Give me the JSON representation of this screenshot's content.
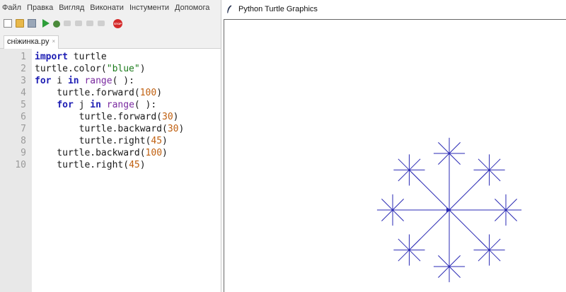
{
  "ide": {
    "menu": [
      "Файл",
      "Правка",
      "Вигляд",
      "Виконати",
      "Інстументи",
      "Допомога"
    ],
    "toolbar": {
      "icons": [
        "new-file-icon",
        "open-folder-icon",
        "save-icon",
        "run-icon",
        "debug-icon",
        "step-over-icon",
        "step-into-icon",
        "step-out-icon",
        "resume-icon",
        "stop-icon"
      ],
      "stop_label": "STOP"
    },
    "tab": {
      "label": "сніжинка.py",
      "close": "×"
    },
    "code_lines": [
      "import turtle",
      "turtle.color(\"blue\")",
      "for i in range( ):",
      "    turtle.forward(100)",
      "    for j in range( ):",
      "        turtle.forward(30)",
      "        turtle.backward(30)",
      "        turtle.right(45)",
      "    turtle.backward(100)",
      "    turtle.right(45)"
    ],
    "line_numbers": [
      "1",
      "2",
      "3",
      "4",
      "5",
      "6",
      "7",
      "8",
      "9",
      "10"
    ]
  },
  "turtle_window": {
    "title": "Python Turtle Graphics",
    "drawing": {
      "color": "#2a2ab4",
      "arm_count": 8,
      "arm_length": 100,
      "branch_length": 30,
      "branch_count": 8,
      "turn_angle": 45
    }
  },
  "colors": {
    "keyword": "#1e1eb4",
    "builtin": "#7a2aa0",
    "number": "#c06010",
    "string": "#1a7a1a",
    "gutter_bg": "#e8e8e8",
    "line_number": "#9a9a9a"
  }
}
